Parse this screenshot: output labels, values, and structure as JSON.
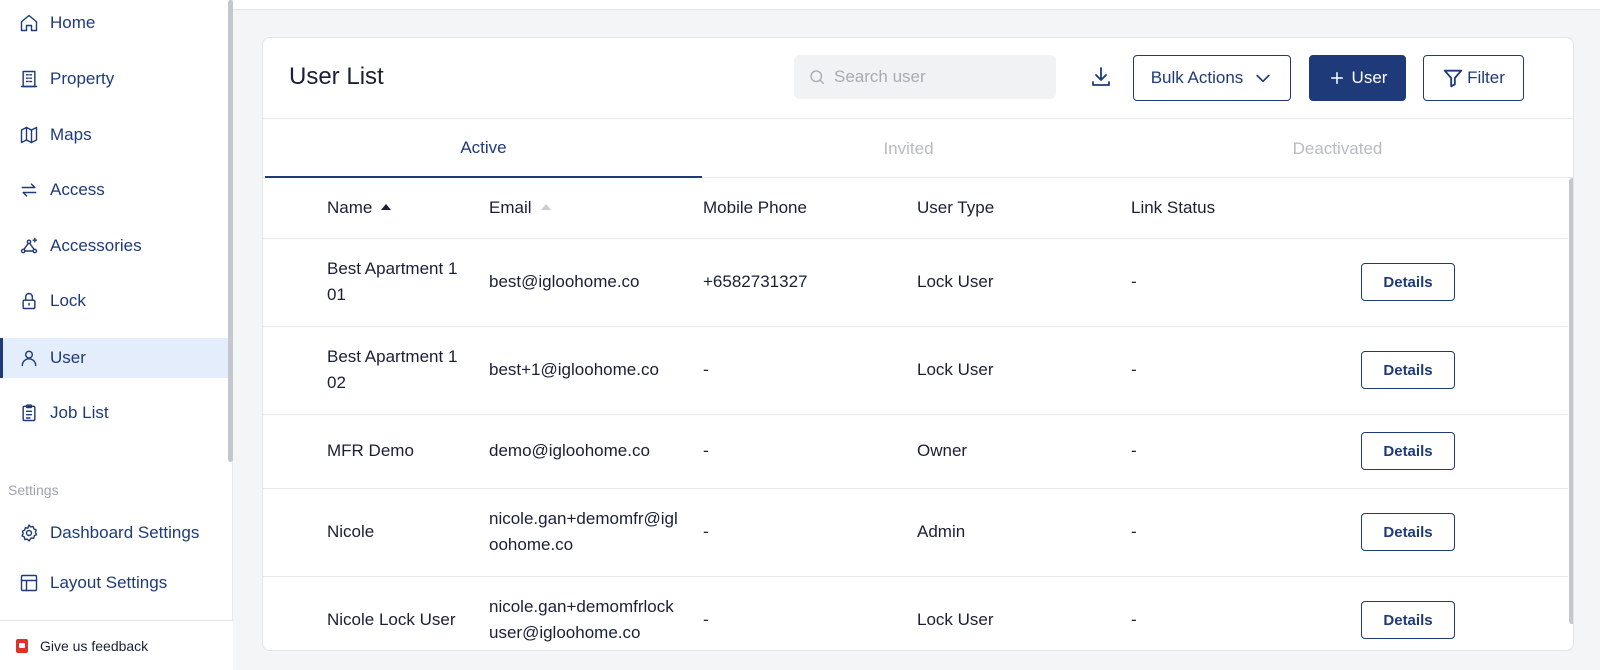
{
  "sidebar": {
    "items": [
      {
        "label": "Home",
        "icon": "home-icon"
      },
      {
        "label": "Property",
        "icon": "building-icon"
      },
      {
        "label": "Maps",
        "icon": "map-icon"
      },
      {
        "label": "Access",
        "icon": "swap-icon"
      },
      {
        "label": "Accessories",
        "icon": "accessories-icon"
      },
      {
        "label": "Lock",
        "icon": "lock-icon"
      },
      {
        "label": "User",
        "icon": "user-icon",
        "active": true
      },
      {
        "label": "Job List",
        "icon": "clipboard-icon"
      }
    ],
    "settings_label": "Settings",
    "settings_items": [
      {
        "label": "Dashboard Settings",
        "icon": "gear-icon"
      },
      {
        "label": "Layout Settings",
        "icon": "layout-icon"
      }
    ],
    "feedback_label": "Give us feedback"
  },
  "header": {
    "title": "User List",
    "search_placeholder": "Search user",
    "bulk_actions_label": "Bulk Actions",
    "add_user_label": "User",
    "filter_label": "Filter"
  },
  "tabs": [
    {
      "label": "Active",
      "active": true
    },
    {
      "label": "Invited"
    },
    {
      "label": "Deactivated"
    }
  ],
  "table": {
    "columns": [
      "Name",
      "Email",
      "Mobile Phone",
      "User Type",
      "Link Status"
    ],
    "details_label": "Details",
    "rows": [
      {
        "name": "Best Apartment 1 01",
        "email": "best@igloohome.co",
        "phone": "+6582731327",
        "type": "Lock User",
        "link": "-"
      },
      {
        "name": "Best Apartment 1 02",
        "email": "best+1@igloohome.co",
        "phone": "-",
        "type": "Lock User",
        "link": "-"
      },
      {
        "name": "MFR Demo",
        "email": "demo@igloohome.co",
        "phone": "-",
        "type": "Owner",
        "link": "-"
      },
      {
        "name": "Nicole",
        "email": "nicole.gan+demomfr@igloohome.co",
        "phone": "-",
        "type": "Admin",
        "link": "-"
      },
      {
        "name": "Nicole Lock User",
        "email": "nicole.gan+demomfrlockuser@igloohome.co",
        "phone": "-",
        "type": "Lock User",
        "link": "-"
      }
    ]
  },
  "colors": {
    "accent": "#1e3a78",
    "active_bg": "#e3edfb"
  }
}
